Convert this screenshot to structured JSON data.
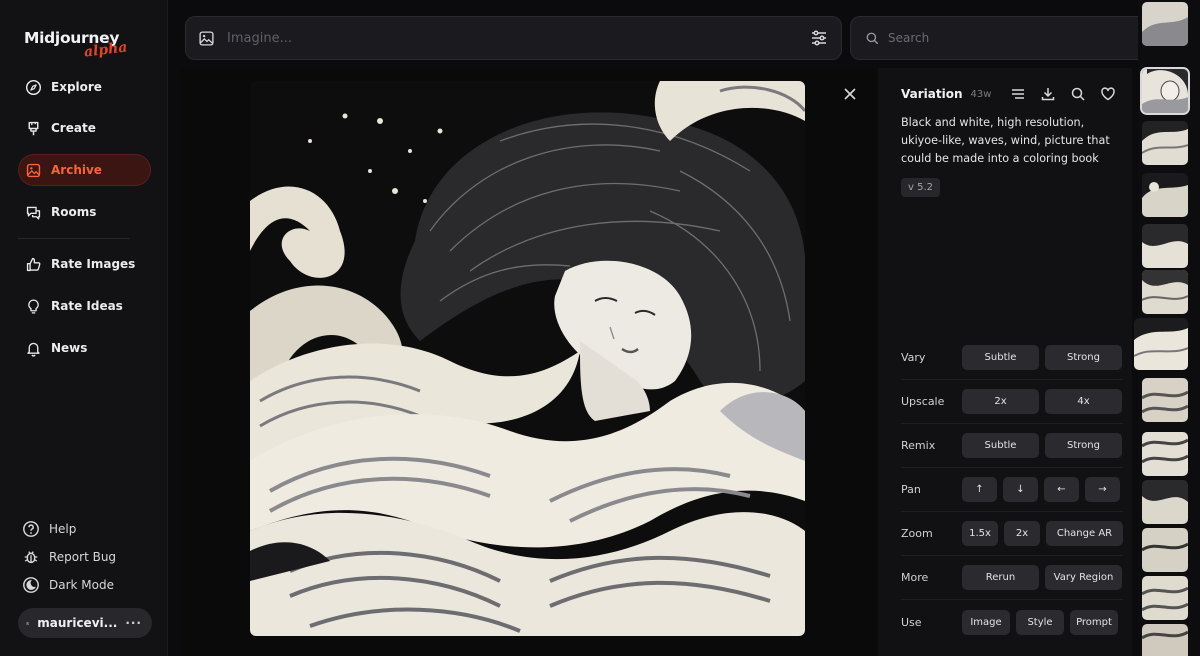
{
  "app": {
    "name": "Midjourney",
    "tag": "alpha"
  },
  "sidebar": {
    "nav": [
      {
        "label": "Explore",
        "icon": "compass-icon"
      },
      {
        "label": "Create",
        "icon": "brush-icon"
      },
      {
        "label": "Archive",
        "icon": "image-icon",
        "active": true
      },
      {
        "label": "Rooms",
        "icon": "chat-icon"
      },
      {
        "label": "Rate Images",
        "icon": "thumbs-up-icon"
      },
      {
        "label": "Rate Ideas",
        "icon": "lightbulb-icon"
      },
      {
        "label": "News",
        "icon": "bell-icon"
      }
    ],
    "footer": [
      {
        "label": "Help",
        "icon": "help-icon"
      },
      {
        "label": "Report Bug",
        "icon": "bug-icon"
      },
      {
        "label": "Dark Mode",
        "icon": "moon-icon"
      }
    ],
    "user": {
      "name": "mauricevi...",
      "more": "···"
    }
  },
  "imagine": {
    "placeholder": "Imagine..."
  },
  "search": {
    "placeholder": "Search"
  },
  "detail": {
    "title": "Variation",
    "age": "43w",
    "prompt": "Black and white, high resolution, ukiyoe-like, waves, wind, picture that could be made into a coloring book",
    "version": "v 5.2",
    "actions": [
      {
        "label": "Vary",
        "buttons": [
          "Subtle",
          "Strong"
        ]
      },
      {
        "label": "Upscale",
        "buttons": [
          "2x",
          "4x"
        ]
      },
      {
        "label": "Remix",
        "buttons": [
          "Subtle",
          "Strong"
        ]
      },
      {
        "label": "Pan",
        "buttons": [
          "↑",
          "↓",
          "←",
          "→"
        ]
      },
      {
        "label": "Zoom",
        "buttons": [
          "1.5x",
          "2x",
          "Change AR"
        ]
      },
      {
        "label": "More",
        "buttons": [
          "Rerun",
          "Vary Region"
        ]
      },
      {
        "label": "Use",
        "buttons": [
          "Image",
          "Style",
          "Prompt"
        ]
      }
    ]
  },
  "colors": {
    "accent": "#f5643f",
    "active_bg": "#3a1512",
    "panel": "#111114"
  }
}
